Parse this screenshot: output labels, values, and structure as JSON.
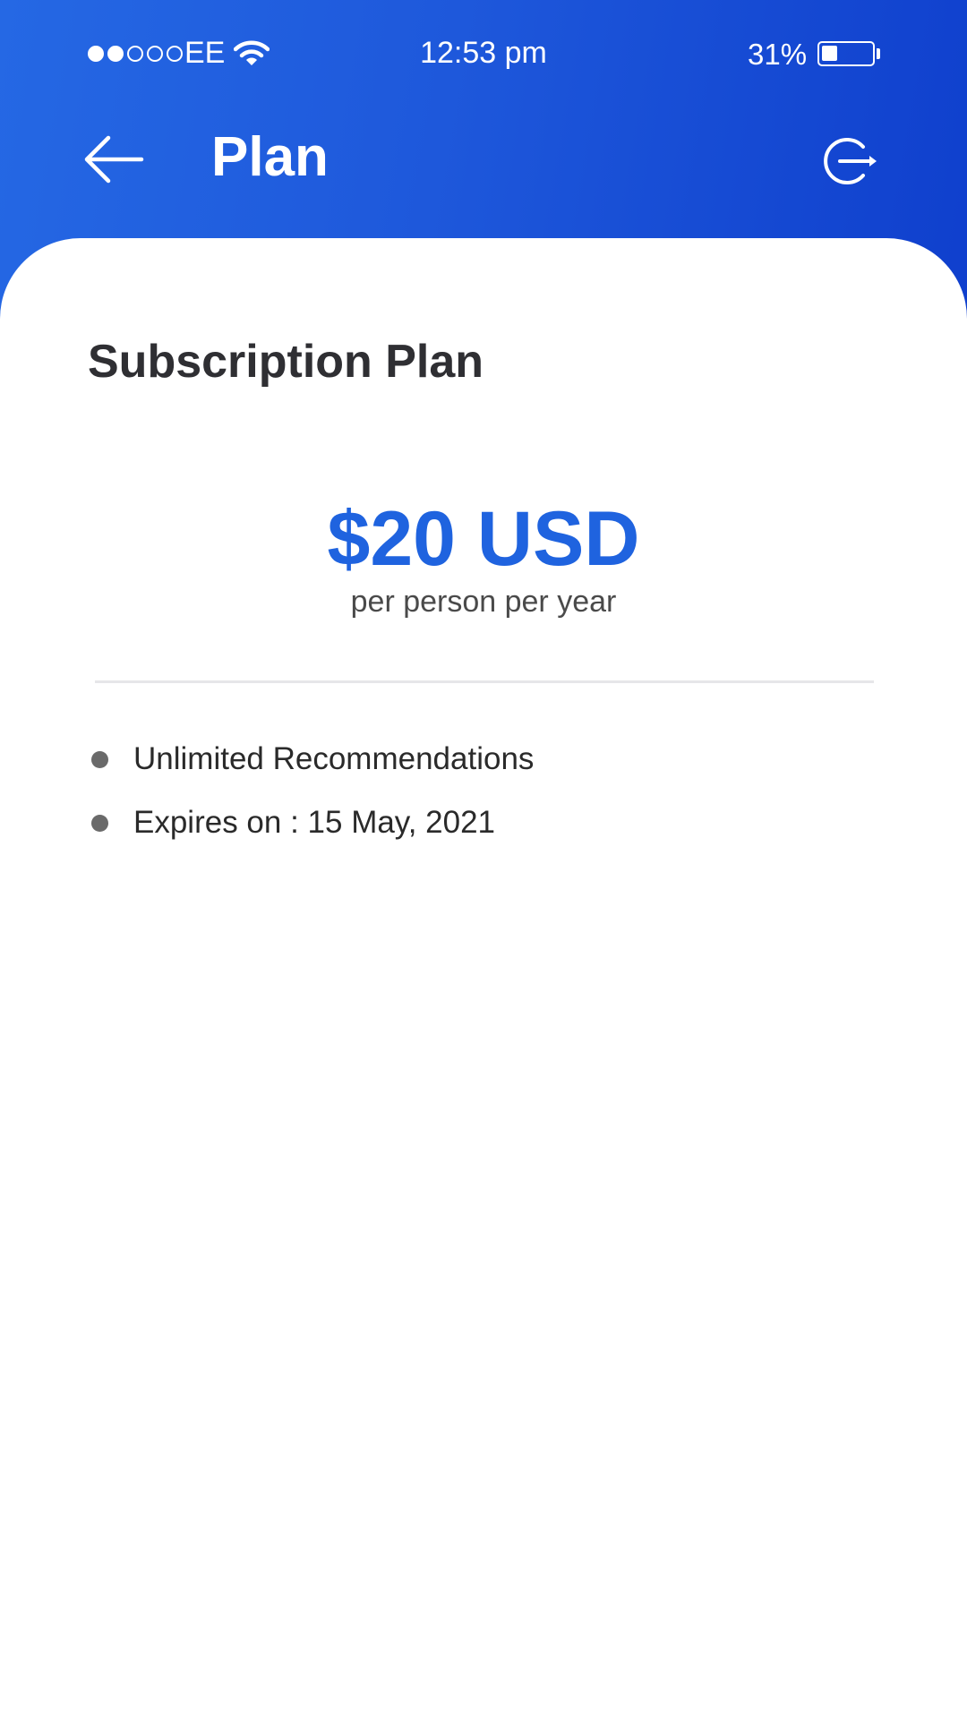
{
  "status_bar": {
    "signal_dots": [
      true,
      true,
      false,
      false,
      false
    ],
    "carrier": "EE",
    "wifi_icon": "wifi-icon",
    "time": "12:53 pm",
    "battery_percent": "31%",
    "battery_level": 0.31
  },
  "header": {
    "back_icon": "arrow-left-icon",
    "title": "Plan",
    "logout_icon": "logout-icon"
  },
  "plan": {
    "section_title": "Subscription Plan",
    "price": "$20 USD",
    "period": "per person per year",
    "features": [
      "Unlimited Recommendations",
      "Expires on : 15 May, 2021"
    ]
  },
  "colors": {
    "brand_blue": "#1f63df",
    "header_gradient_start": "#2568e4",
    "header_gradient_end": "#0f3fcd",
    "heading_text": "#2f2f33"
  }
}
